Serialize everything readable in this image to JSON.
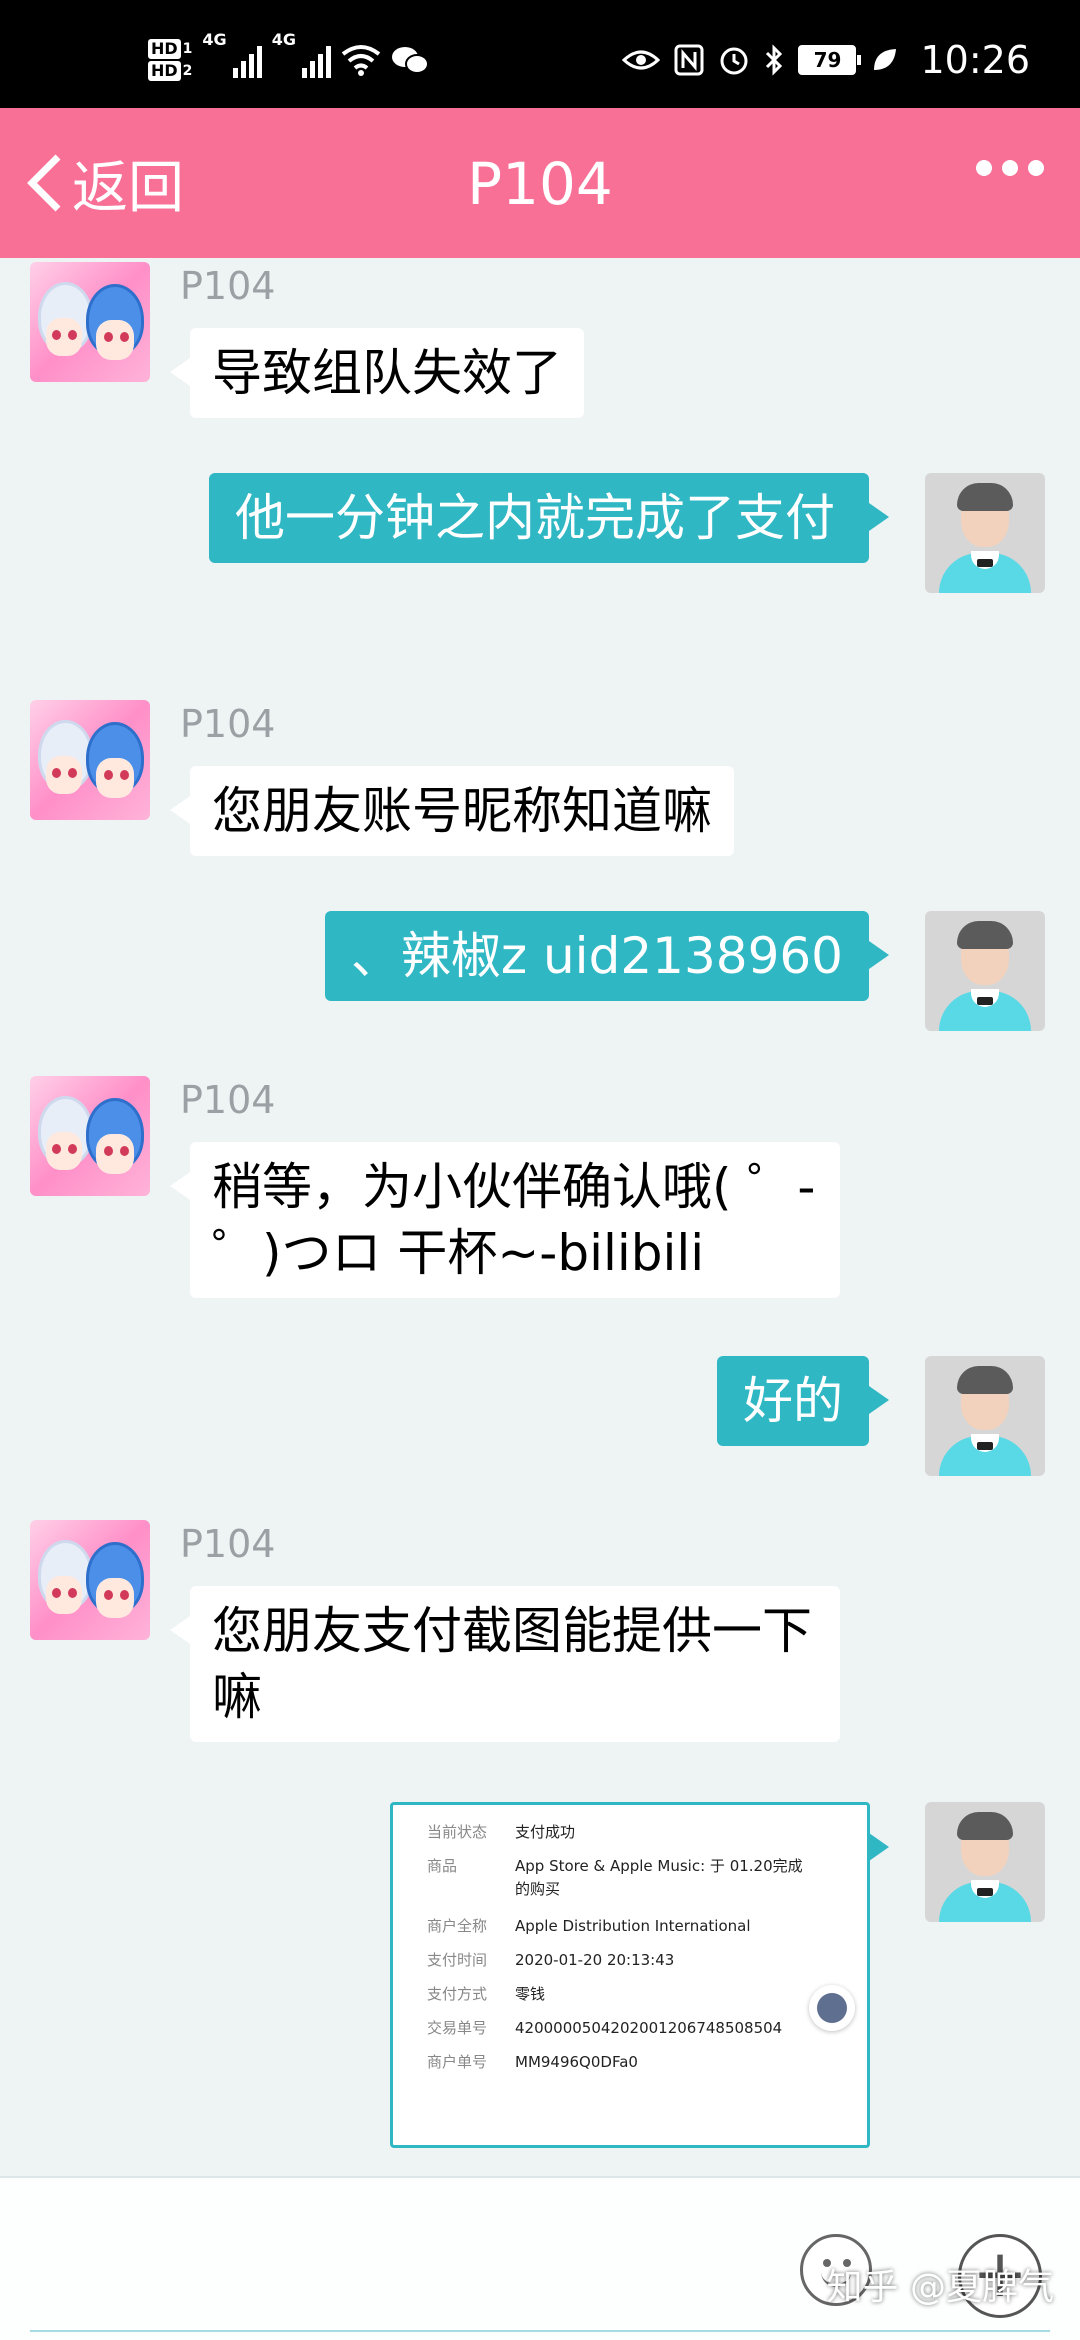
{
  "status_bar": {
    "hd1": "HD",
    "hd1_sub": "1",
    "hd2": "HD",
    "hd2_sub": "2",
    "net1": "4G",
    "net2": "4G",
    "battery": "79",
    "time": "10:26"
  },
  "header": {
    "back_label": "返回",
    "title": "P104",
    "more_icon": "more-dots-icon"
  },
  "messages": [
    {
      "dir": "in",
      "sender": "P104",
      "text": "导致组队失效了"
    },
    {
      "dir": "out",
      "text": "他一分钟之内就完成了支付"
    },
    {
      "dir": "in",
      "sender": "P104",
      "text": "您朋友账号昵称知道嘛"
    },
    {
      "dir": "out",
      "text": "、辣椒z uid2138960"
    },
    {
      "dir": "in",
      "sender": "P104",
      "text": "稍等，为小伙伴确认哦( ゜- ゜)つロ 干杯~-bilibili"
    },
    {
      "dir": "out",
      "text": "好的"
    },
    {
      "dir": "in",
      "sender": "P104",
      "text": "您朋友支付截图能提供一下嘛"
    }
  ],
  "receipt": {
    "rows": [
      {
        "label": "当前状态",
        "value": "支付成功"
      },
      {
        "label": "商品",
        "value": "App Store & Apple Music: 于 01.20完成的购买"
      },
      {
        "label": "商户全称",
        "value": "Apple Distribution International"
      },
      {
        "label": "支付时间",
        "value": "2020-01-20 20:13:43"
      },
      {
        "label": "支付方式",
        "value": "零钱"
      },
      {
        "label": "交易单号",
        "value": "4200000504202001206748508504"
      },
      {
        "label": "商户单号",
        "value": "MM9496Q0DFa0"
      }
    ]
  },
  "input_bar": {
    "plus": "+",
    "watermark": "知乎 @夏脾气"
  },
  "colors": {
    "header_bg": "#f87096",
    "bubble_out": "#2fb7c4",
    "bubble_in": "#ffffff",
    "chat_bg": "#eef3f4"
  }
}
